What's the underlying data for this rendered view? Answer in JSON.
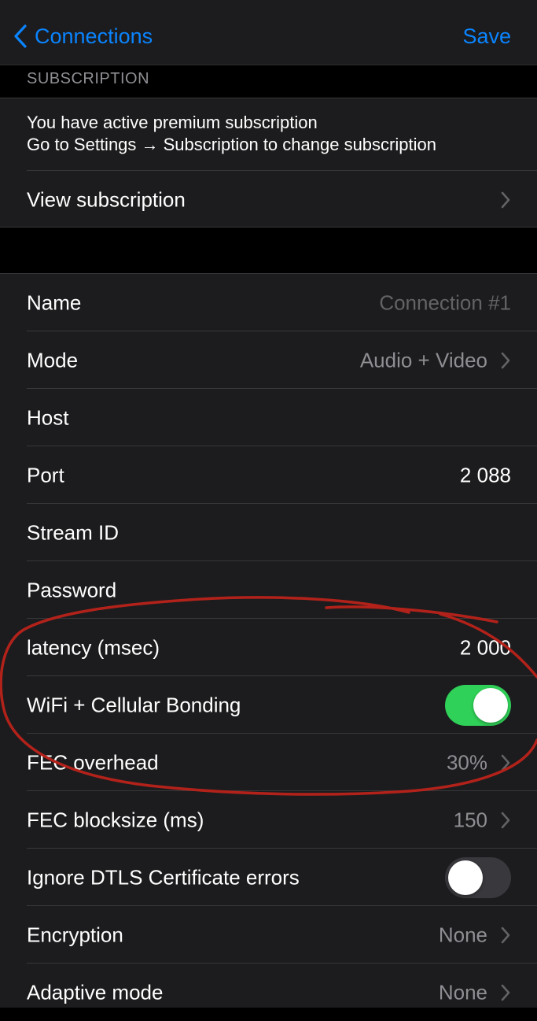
{
  "nav": {
    "back_label": "Connections",
    "save_label": "Save"
  },
  "subscription": {
    "header": "SUBSCRIPTION",
    "line1": "You have active premium subscription",
    "line2": "Go to Settings → Subscription to change subscription",
    "view_label": "View subscription"
  },
  "settings": {
    "name": {
      "label": "Name",
      "placeholder": "Connection #1"
    },
    "mode": {
      "label": "Mode",
      "value": "Audio + Video"
    },
    "host": {
      "label": "Host"
    },
    "port": {
      "label": "Port",
      "value": "2 088"
    },
    "stream_id": {
      "label": "Stream ID"
    },
    "password": {
      "label": "Password"
    },
    "latency": {
      "label": "latency (msec)",
      "value": "2 000"
    },
    "bonding": {
      "label": "WiFi + Cellular Bonding",
      "enabled": true
    },
    "fec_overhead": {
      "label": "FEC overhead",
      "value": "30%"
    },
    "fec_blocksize": {
      "label": "FEC blocksize (ms)",
      "value": "150"
    },
    "ignore_dtls": {
      "label": "Ignore DTLS Certificate errors",
      "enabled": false
    },
    "encryption": {
      "label": "Encryption",
      "value": "None"
    },
    "adaptive_mode": {
      "label": "Adaptive mode",
      "value": "None"
    }
  },
  "colors": {
    "accent": "#0a84ff",
    "toggle_on": "#30d158",
    "annotation": "#b3221a"
  }
}
